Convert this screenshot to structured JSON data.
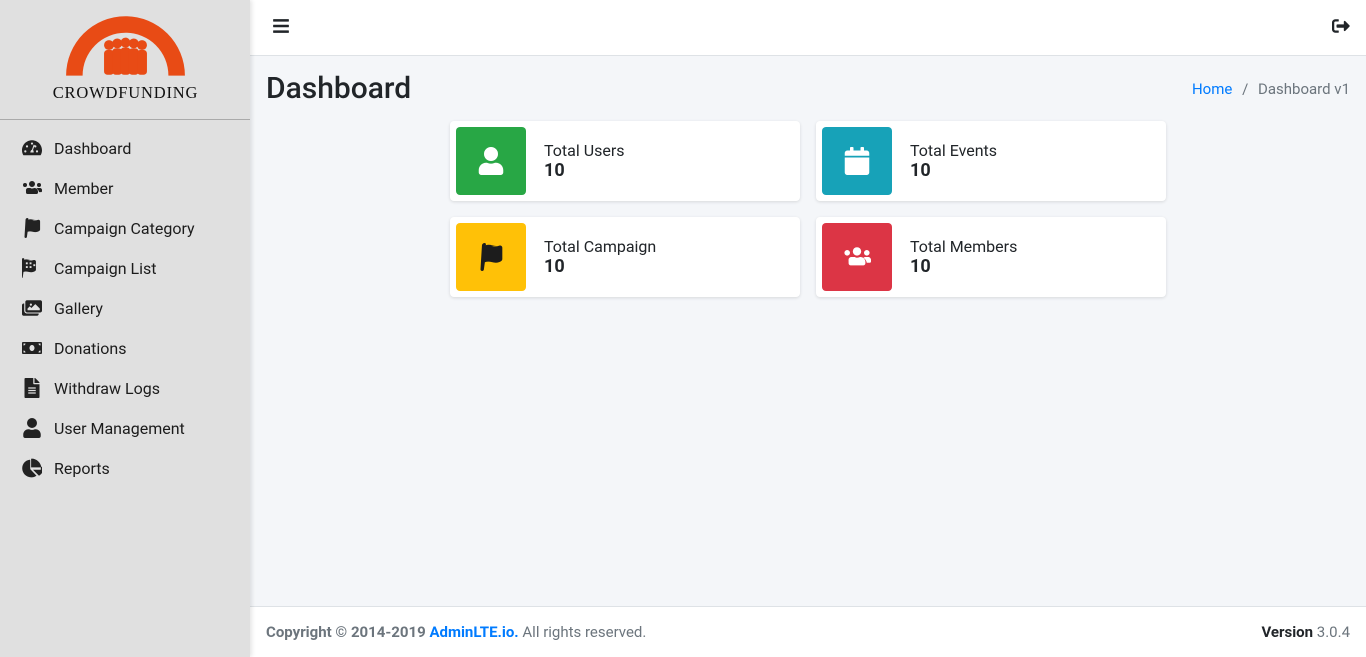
{
  "brand": {
    "name": "CROWDFUNDING"
  },
  "sidebar": {
    "items": [
      {
        "label": "Dashboard"
      },
      {
        "label": "Member"
      },
      {
        "label": "Campaign Category"
      },
      {
        "label": "Campaign List"
      },
      {
        "label": "Gallery"
      },
      {
        "label": "Donations"
      },
      {
        "label": "Withdraw Logs"
      },
      {
        "label": "User Management"
      },
      {
        "label": "Reports"
      }
    ]
  },
  "header": {
    "title": "Dashboard"
  },
  "breadcrumb": {
    "home": "Home",
    "current": "Dashboard v1"
  },
  "stats": {
    "users": {
      "label": "Total Users",
      "value": "10"
    },
    "events": {
      "label": "Total Events",
      "value": "10"
    },
    "campaign": {
      "label": "Total Campaign",
      "value": "10"
    },
    "members": {
      "label": "Total Members",
      "value": "10"
    }
  },
  "footer": {
    "copyright_prefix": "Copyright © 2014-2019 ",
    "brand_link": "AdminLTE.io.",
    "rights": " All rights reserved.",
    "version_label": "Version ",
    "version": "3.0.4"
  }
}
